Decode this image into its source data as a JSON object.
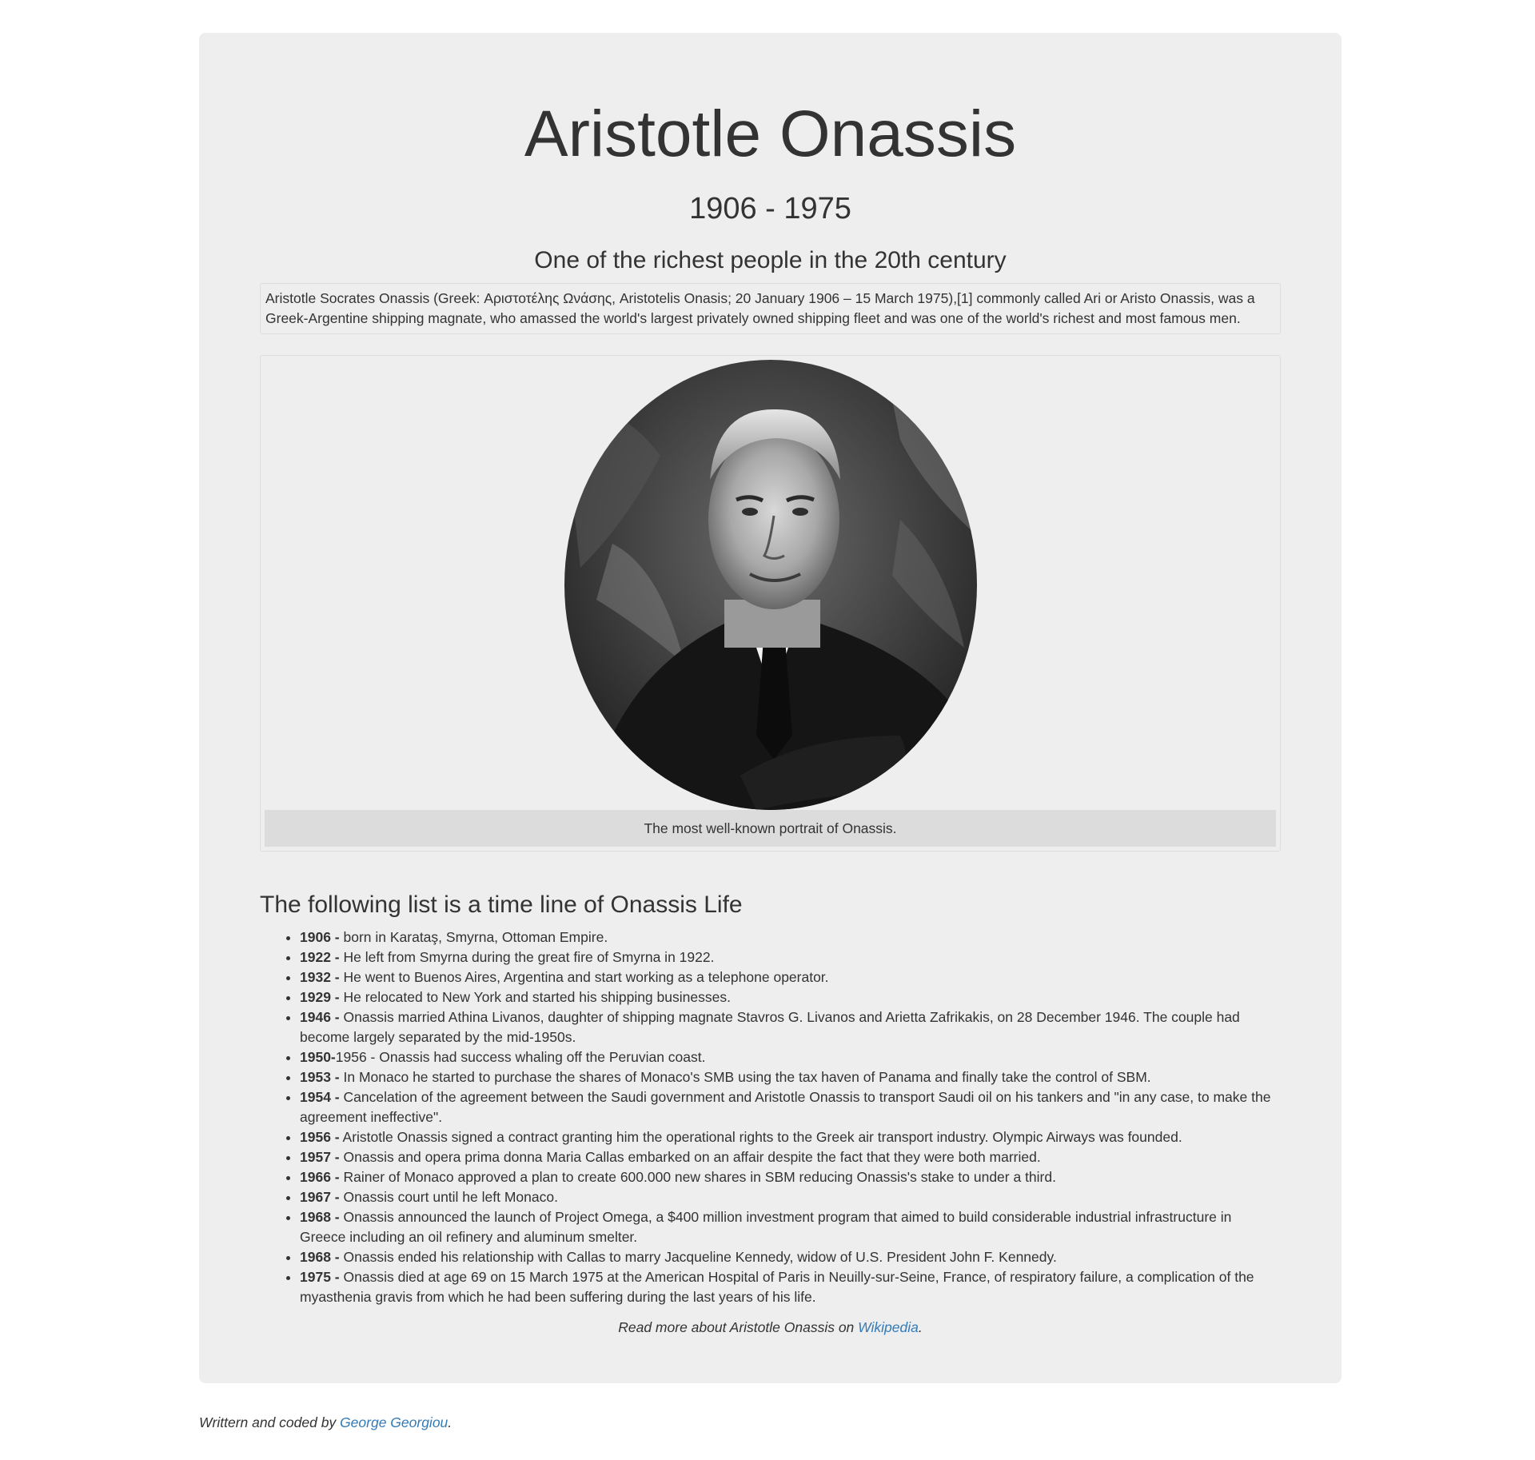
{
  "page": {
    "title": "Aristotle Onassis",
    "years": "1906 - 1975",
    "subtitle": "One of the richest people in the 20th century",
    "intro": "Aristotle Socrates Onassis (Greek: Αριστοτέλης Ωνάσης, Aristotelis Onasis; 20 January 1906 – 15 March 1975),[1] commonly called Ari or Aristo Onassis, was a Greek-Argentine shipping magnate, who amassed the world's largest privately owned shipping fleet and was one of the world's richest and most famous men."
  },
  "portrait": {
    "caption": "The most well-known portrait of Onassis."
  },
  "timeline": {
    "heading": "The following list is a time line of Onassis Life",
    "items": [
      {
        "year": "1906 -",
        "text": " born in Karataş, Smyrna, Ottoman Empire."
      },
      {
        "year": "1922 -",
        "text": " He left from Smyrna during the great fire of Smyrna in 1922."
      },
      {
        "year": "1932 -",
        "text": " He went to Buenos Aires, Argentina and start working as a telephone operator."
      },
      {
        "year": "1929 -",
        "text": " He relocated to New York and started his shipping businesses."
      },
      {
        "year": "1946 -",
        "text": " Onassis married Athina Livanos, daughter of shipping magnate Stavros G. Livanos and Arietta Zafrikakis, on 28 December 1946. The couple had become largely separated by the mid-1950s."
      },
      {
        "year": "1950-",
        "text": "1956 - Onassis had success whaling off the Peruvian coast."
      },
      {
        "year": "1953 -",
        "text": " In Monaco he started to purchase the shares of Monaco's SMB using the tax haven of Panama and finally take the control of SBM."
      },
      {
        "year": "1954 -",
        "text": " Cancelation of the agreement between the Saudi government and Aristotle Onassis to transport Saudi oil on his tankers and \"in any case, to make the agreement ineffective\"."
      },
      {
        "year": "1956 -",
        "text": " Aristotle Onassis signed a contract granting him the operational rights to the Greek air transport industry. Olympic Airways was founded."
      },
      {
        "year": "1957 -",
        "text": " Onassis and opera prima donna Maria Callas embarked on an affair despite the fact that they were both married."
      },
      {
        "year": "1966 -",
        "text": " Rainer of Monaco approved a plan to create 600.000 new shares in SBM reducing Onassis's stake to under a third."
      },
      {
        "year": "1967 -",
        "text": " Onassis court until he left Monaco."
      },
      {
        "year": "1968 -",
        "text": " Onassis announced the launch of Project Omega, a $400 million investment program that aimed to build considerable industrial infrastructure in Greece including an oil refinery and aluminum smelter."
      },
      {
        "year": "1968 -",
        "text": " Onassis ended his relationship with Callas to marry Jacqueline Kennedy, widow of U.S. President John F. Kennedy."
      },
      {
        "year": "1975 -",
        "text": " Onassis died at age 69 on 15 March 1975 at the American Hospital of Paris in Neuilly-sur-Seine, France, of respiratory failure, a complication of the myasthenia gravis from which he had been suffering during the last years of his life."
      }
    ]
  },
  "readmore": {
    "prefix": "Read more about Aristotle Onassis on ",
    "link_text": "Wikipedia",
    "suffix": "."
  },
  "footer": {
    "prefix": "Writtern and coded by ",
    "link_text": "George Georgiou",
    "suffix": "."
  },
  "colors": {
    "jumbotron_bg": "#eeeeee",
    "caption_bg": "#dcdcdc",
    "link": "#337ab7",
    "text": "#333333"
  }
}
